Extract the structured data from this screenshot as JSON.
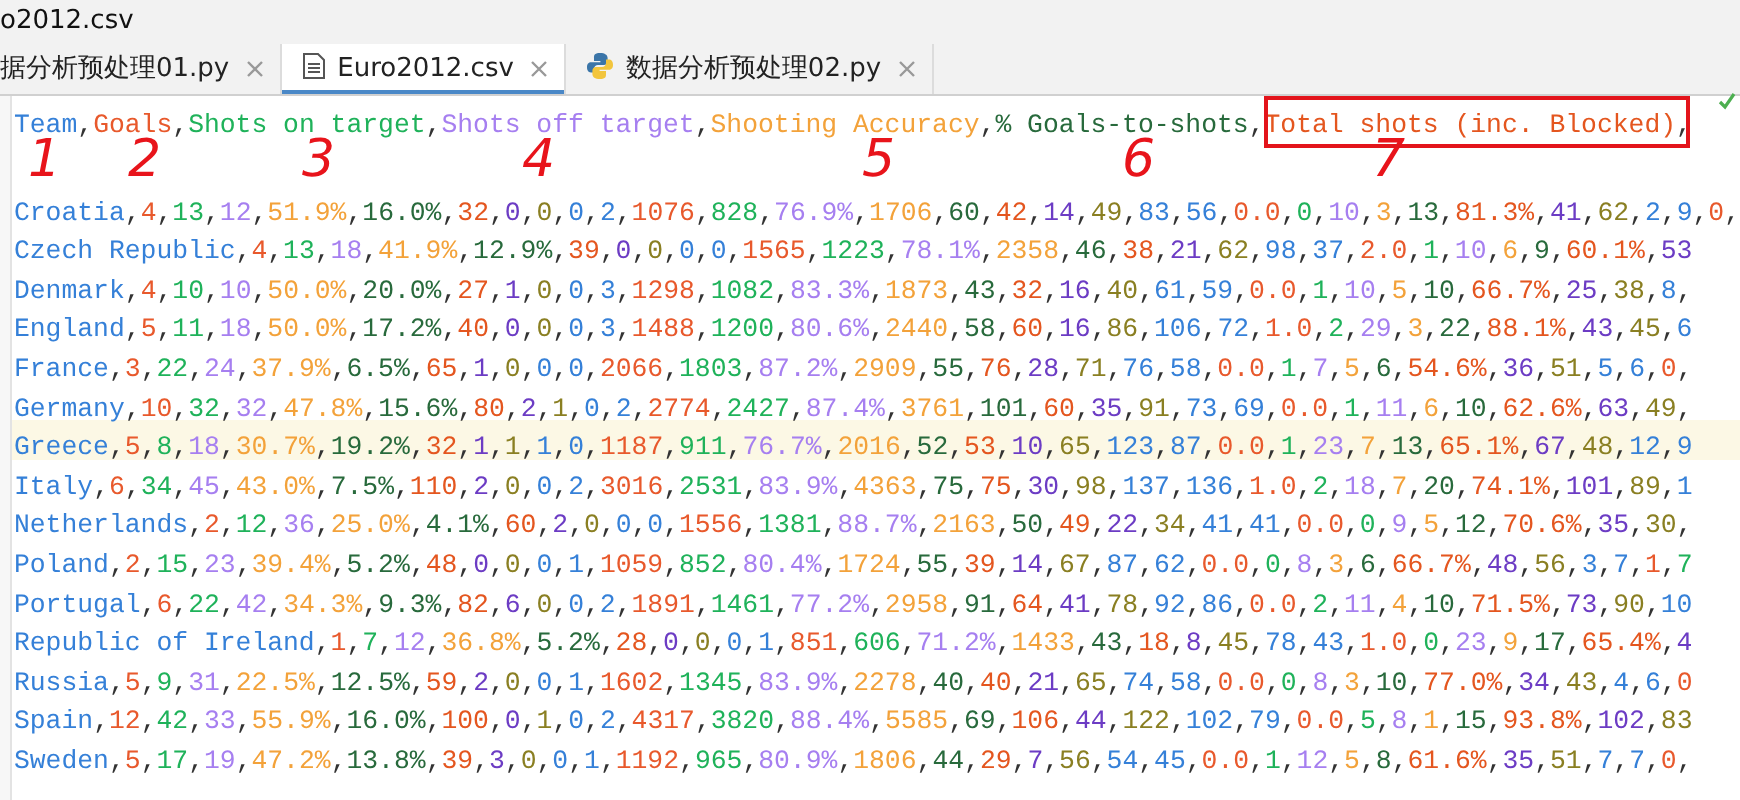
{
  "title": "o2012.csv",
  "tabs": [
    {
      "label": "据分析预处理01.py",
      "selected": false
    },
    {
      "label": "Euro2012.csv",
      "selected": true,
      "kind": "csv"
    },
    {
      "label": "数据分析预处理02.py",
      "selected": false,
      "kind": "python"
    }
  ],
  "lines": [
    {
      "text": "Team,Goals,Shots on target,Shots off target,Shooting Accuracy,% Goals-to-shots,Total shots (inc. Blocked),",
      "current": false
    },
    {
      "text": "Croatia,4,13,12,51.9%,16.0%,32,0,0,0,2,1076,828,76.9%,1706,60,42,14,49,83,56,0.0,0,10,3,13,81.3%,41,62,2,9,0,",
      "current": false
    },
    {
      "text": "Czech Republic,4,13,18,41.9%,12.9%,39,0,0,0,0,1565,1223,78.1%,2358,46,38,21,62,98,37,2.0,1,10,6,9,60.1%,53",
      "current": false
    },
    {
      "text": "Denmark,4,10,10,50.0%,20.0%,27,1,0,0,3,1298,1082,83.3%,1873,43,32,16,40,61,59,0.0,1,10,5,10,66.7%,25,38,8,",
      "current": false
    },
    {
      "text": "England,5,11,18,50.0%,17.2%,40,0,0,0,3,1488,1200,80.6%,2440,58,60,16,86,106,72,1.0,2,29,3,22,88.1%,43,45,6",
      "current": false
    },
    {
      "text": "France,3,22,24,37.9%,6.5%,65,1,0,0,0,2066,1803,87.2%,2909,55,76,28,71,76,58,0.0,1,7,5,6,54.6%,36,51,5,6,0,",
      "current": false
    },
    {
      "text": "Germany,10,32,32,47.8%,15.6%,80,2,1,0,2,2774,2427,87.4%,3761,101,60,35,91,73,69,0.0,1,11,6,10,62.6%,63,49,",
      "current": false
    },
    {
      "text": "Greece,5,8,18,30.7%,19.2%,32,1,1,1,0,1187,911,76.7%,2016,52,53,10,65,123,87,0.0,1,23,7,13,65.1%,67,48,12,9",
      "current": true
    },
    {
      "text": "Italy,6,34,45,43.0%,7.5%,110,2,0,0,2,3016,2531,83.9%,4363,75,75,30,98,137,136,1.0,2,18,7,20,74.1%,101,89,1",
      "current": false
    },
    {
      "text": "Netherlands,2,12,36,25.0%,4.1%,60,2,0,0,0,1556,1381,88.7%,2163,50,49,22,34,41,41,0.0,0,9,5,12,70.6%,35,30,",
      "current": false
    },
    {
      "text": "Poland,2,15,23,39.4%,5.2%,48,0,0,0,1,1059,852,80.4%,1724,55,39,14,67,87,62,0.0,0,8,3,6,66.7%,48,56,3,7,1,7",
      "current": false
    },
    {
      "text": "Portugal,6,22,42,34.3%,9.3%,82,6,0,0,2,1891,1461,77.2%,2958,91,64,41,78,92,86,0.0,2,11,4,10,71.5%,73,90,10",
      "current": false
    },
    {
      "text": "Republic of Ireland,1,7,12,36.8%,5.2%,28,0,0,0,1,851,606,71.2%,1433,43,18,8,45,78,43,1.0,0,23,9,17,65.4%,4",
      "current": false
    },
    {
      "text": "Russia,5,9,31,22.5%,12.5%,59,2,0,0,1,1602,1345,83.9%,2278,40,40,21,65,74,58,0.0,0,8,3,10,77.0%,34,43,4,6,0",
      "current": false
    },
    {
      "text": "Spain,12,42,33,55.9%,16.0%,100,0,1,0,2,4317,3820,88.4%,5585,69,106,44,122,102,79,0.0,5,8,1,15,93.8%,102,83",
      "current": false
    },
    {
      "text": "Sweden,5,17,19,47.2%,13.8%,39,3,0,0,1,1192,965,80.9%,1806,44,29,7,56,54,45,0.0,1,12,5,8,61.6%,35,51,7,7,0,",
      "current": false
    }
  ],
  "annotations": [
    "1",
    "2",
    "3",
    "4",
    "5",
    "6",
    "7"
  ],
  "annotation_box": true
}
